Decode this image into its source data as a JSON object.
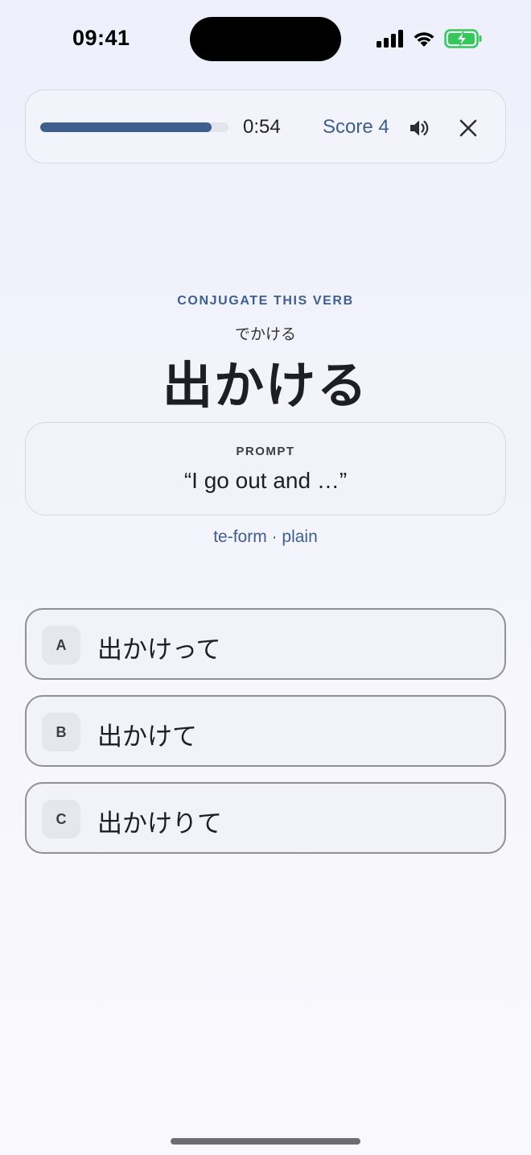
{
  "status_bar": {
    "time": "09:41",
    "icons": [
      "cellular-signal-icon",
      "wifi-icon",
      "battery-charging-icon"
    ],
    "battery_color": "#34c759"
  },
  "header": {
    "progress": 0.91,
    "timer": "0:54",
    "score_label": "Score",
    "score_value": "4",
    "sound_icon": "speaker-icon",
    "close_icon": "close-icon",
    "accent_color": "#3e5f8e"
  },
  "question": {
    "instruction": "CONJUGATE THIS VERB",
    "reading": "でかける",
    "verb": "出かける",
    "prompt_label": "PROMPT",
    "prompt_text": "“I go out and …”",
    "form": "te-form · plain"
  },
  "options": [
    {
      "letter": "A",
      "text": "出かけって"
    },
    {
      "letter": "B",
      "text": "出かけて"
    },
    {
      "letter": "C",
      "text": "出かけりて"
    }
  ]
}
